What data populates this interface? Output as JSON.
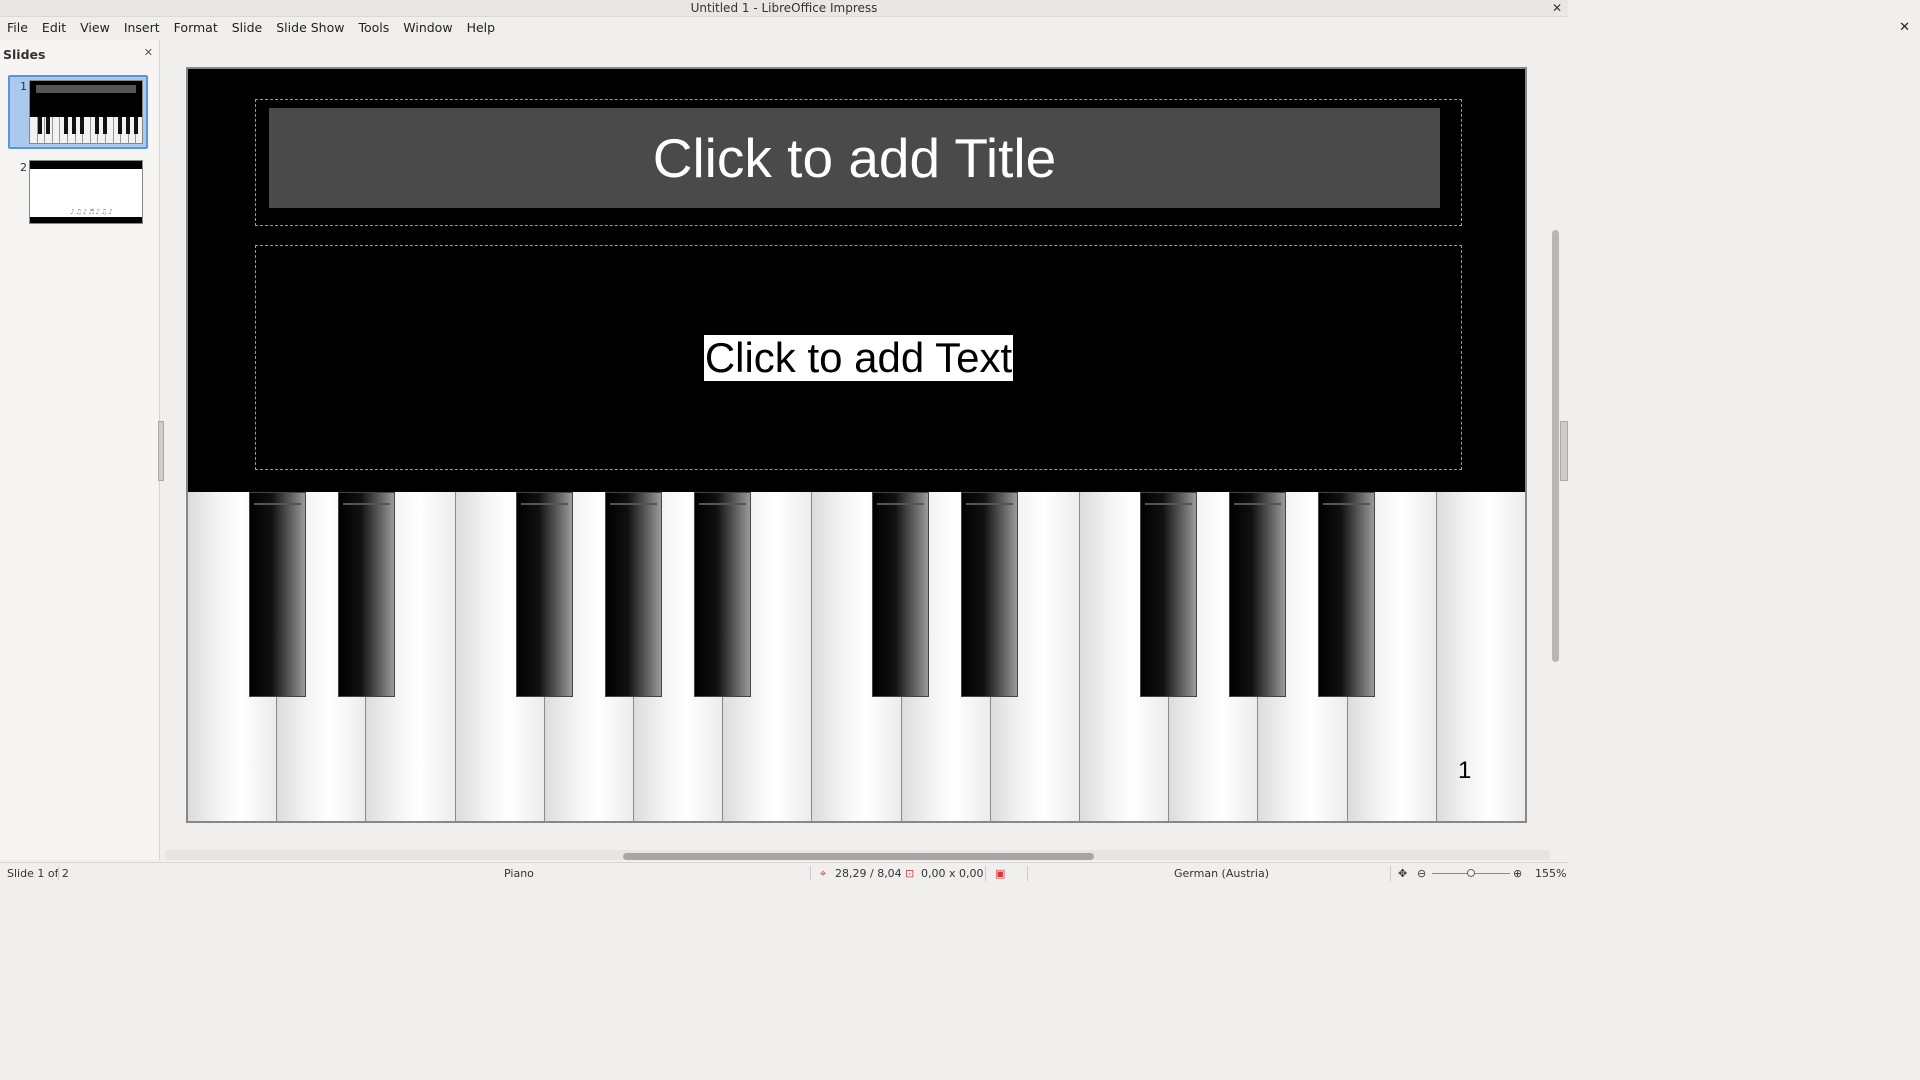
{
  "window": {
    "title": "Untitled 1 - LibreOffice Impress"
  },
  "menu": [
    "File",
    "Edit",
    "View",
    "Insert",
    "Format",
    "Slide",
    "Slide Show",
    "Tools",
    "Window",
    "Help"
  ],
  "sidebar": {
    "title": "Slides",
    "slides": [
      {
        "number": "1",
        "selected": true
      },
      {
        "number": "2",
        "selected": false
      }
    ]
  },
  "slide": {
    "title_placeholder": "Click to add Title",
    "body_placeholder": "Click to add Text",
    "page_number": "1"
  },
  "status": {
    "slide_info": "Slide 1 of 2",
    "master": "Piano",
    "position": "28,29 / 8,04",
    "size": "0,00 x 0,00",
    "language": "German (Austria)",
    "zoom": "155%"
  },
  "icons": {
    "close": "close-icon",
    "position": "position-icon",
    "size": "size-icon",
    "signature": "document-modified-icon",
    "fit": "fit-slide-icon",
    "zoom_out": "zoom-out-icon",
    "zoom_in": "zoom-in-icon"
  }
}
